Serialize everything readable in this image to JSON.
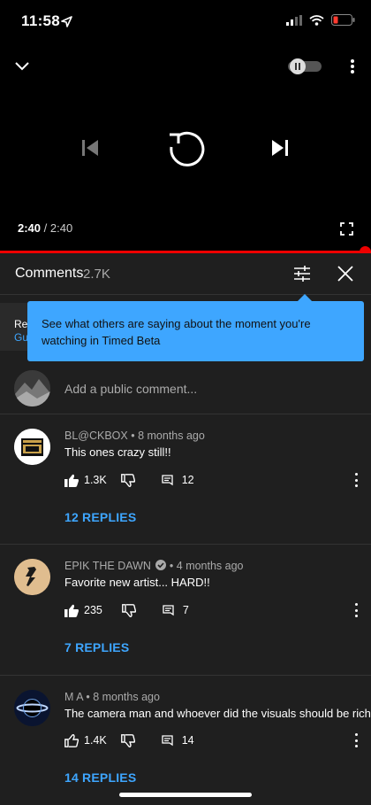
{
  "status": {
    "time": "11:58"
  },
  "player": {
    "current_time": "2:40",
    "separator": "/",
    "duration": "2:40",
    "progress": 1.0
  },
  "comments": {
    "title": "Comments",
    "count": "2.7K",
    "hidden_row_line1": "Re",
    "hidden_row_line2": "Gu",
    "tooltip": "See what others are saying about the moment you're watching in Timed Beta",
    "add_placeholder": "Add a public comment...",
    "items": [
      {
        "author": "BL@CKBOX",
        "age": "8 months ago",
        "text": "This ones crazy still!!",
        "likes": "1.3K",
        "reply_count": "12",
        "replies_label": "12 REPLIES",
        "liked": true
      },
      {
        "author": "EPIK THE DAWN",
        "age": "4 months ago",
        "text": "Favorite new artist... HARD!!",
        "likes": "235",
        "reply_count": "7",
        "replies_label": "7 REPLIES",
        "liked": true,
        "verified": true
      },
      {
        "author": "M A",
        "age": "8 months ago",
        "text": "The camera man and whoever did the visuals should be rich",
        "likes": "1.4K",
        "reply_count": "14",
        "replies_label": "14 REPLIES",
        "liked": false
      }
    ]
  },
  "colors": {
    "accent": "#3ea6ff",
    "progress": "#ee0000",
    "panel": "#1f1f1f"
  }
}
